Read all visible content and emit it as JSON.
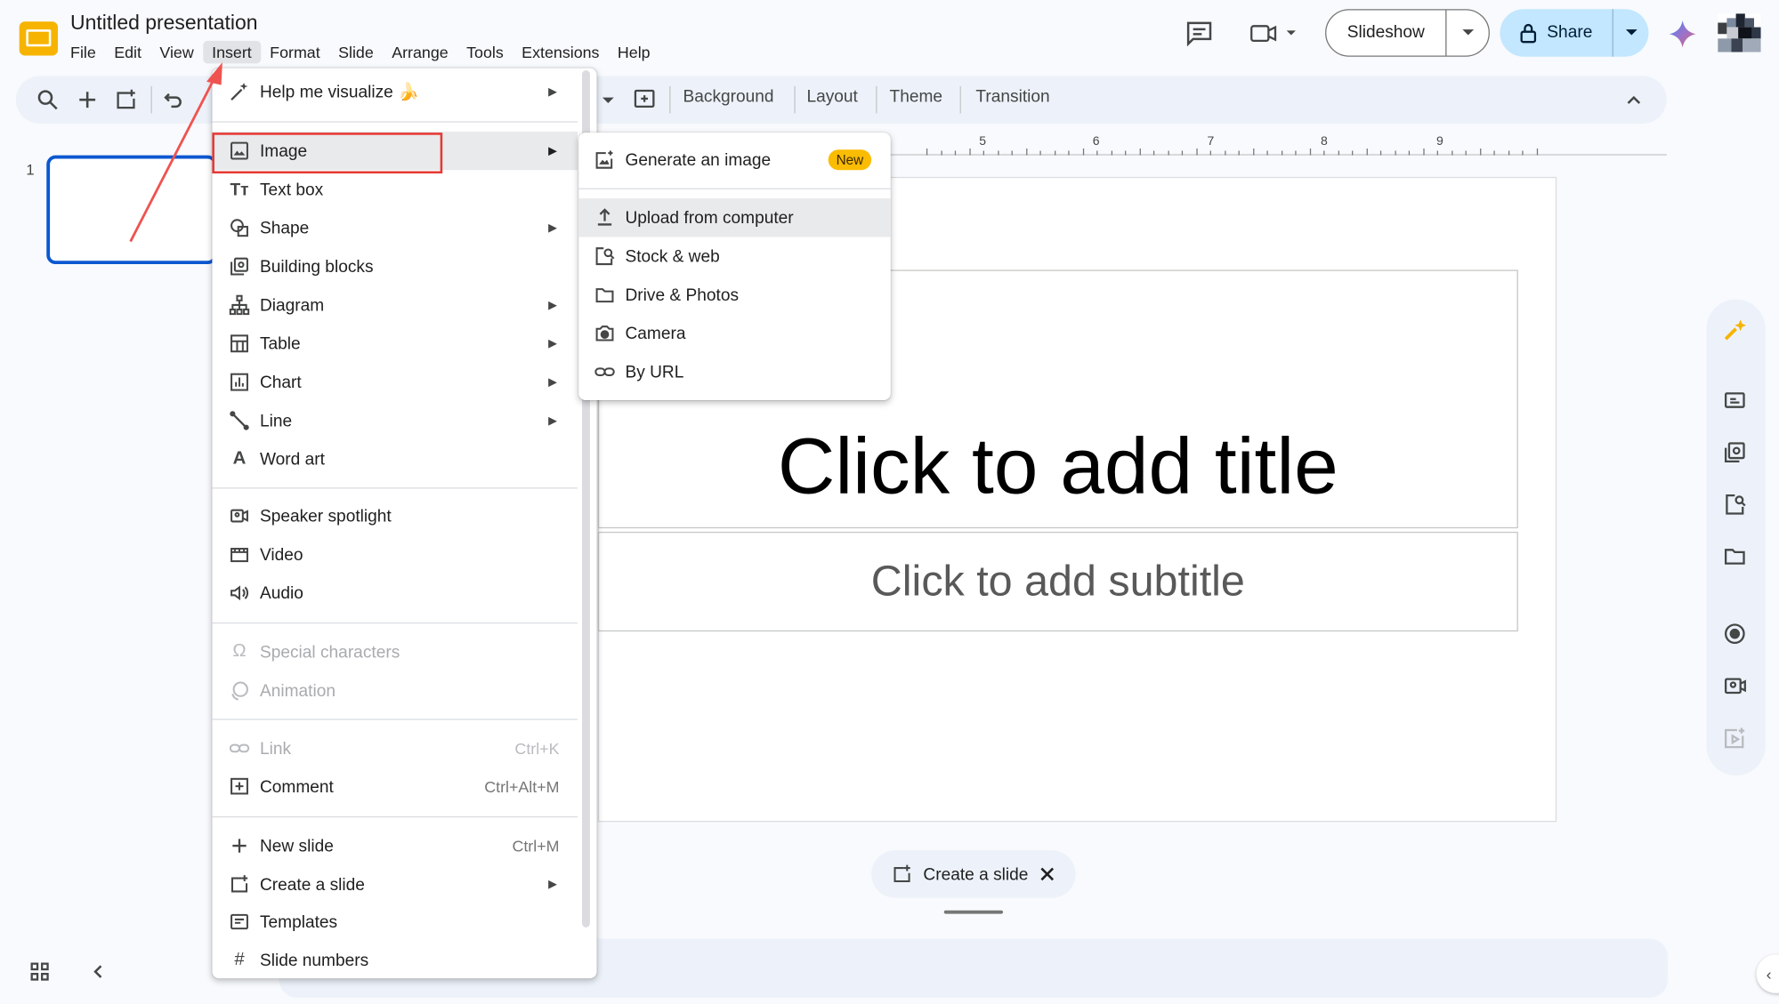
{
  "app": {
    "doc_title": "Untitled presentation",
    "menu": [
      "File",
      "Edit",
      "View",
      "Insert",
      "Format",
      "Slide",
      "Arrange",
      "Tools",
      "Extensions",
      "Help"
    ],
    "active_menu": "Insert"
  },
  "header": {
    "slideshow_label": "Slideshow",
    "share_label": "Share"
  },
  "toolbar": {
    "background": "Background",
    "layout": "Layout",
    "theme": "Theme",
    "transition": "Transition"
  },
  "filmstrip": {
    "slide_number": "1"
  },
  "ruler": {
    "marks": [
      "5",
      "6",
      "7",
      "8",
      "9"
    ]
  },
  "slide": {
    "title_placeholder": "Click to add title",
    "subtitle_placeholder": "Click to add subtitle"
  },
  "create_slide": {
    "label": "Create a slide"
  },
  "insert_menu": {
    "help_me_visualize": "Help me visualize 🍌",
    "items": {
      "image": "Image",
      "text_box": "Text box",
      "shape": "Shape",
      "building_blocks": "Building blocks",
      "diagram": "Diagram",
      "table": "Table",
      "chart": "Chart",
      "line": "Line",
      "word_art": "Word art",
      "speaker_spotlight": "Speaker spotlight",
      "video": "Video",
      "audio": "Audio",
      "special_characters": "Special characters",
      "animation": "Animation",
      "link": "Link",
      "comment": "Comment",
      "new_slide": "New slide",
      "create_a_slide": "Create a slide",
      "templates": "Templates",
      "slide_numbers": "Slide numbers"
    },
    "shortcuts": {
      "link": "Ctrl+K",
      "comment": "Ctrl+Alt+M",
      "new_slide": "Ctrl+M"
    }
  },
  "image_submenu": {
    "generate": "Generate an image",
    "new_badge": "New",
    "upload": "Upload from computer",
    "stock": "Stock & web",
    "drive": "Drive & Photos",
    "camera": "Camera",
    "url": "By URL"
  },
  "colors": {
    "accent_blue": "#0b57d0",
    "share_bg": "#c2e7ff",
    "annotation_red": "#e53935",
    "new_badge": "#fbbc04"
  }
}
